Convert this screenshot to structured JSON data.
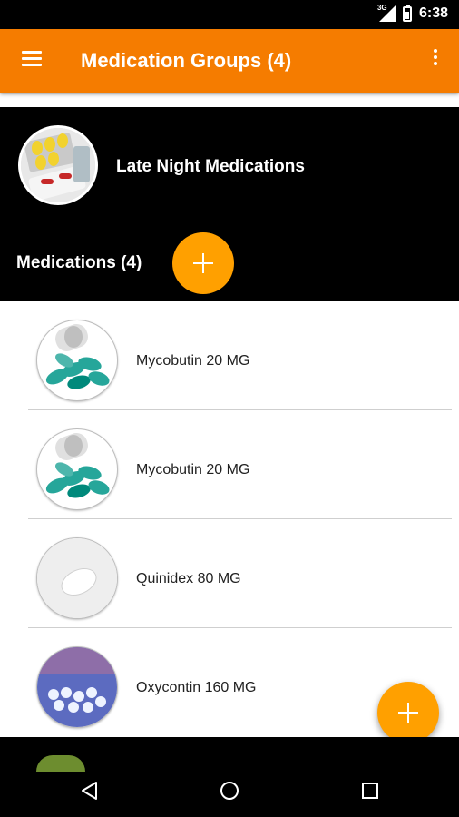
{
  "status_bar": {
    "network": "3G",
    "time": "6:38"
  },
  "app_bar": {
    "title": "Medication Groups (4)",
    "menu_icon": "hamburger-icon",
    "overflow_icon": "more-vert-icon",
    "color": "#f57c00"
  },
  "group": {
    "name": "Late Night Medications",
    "medications_label": "Medications (4)"
  },
  "medications": [
    {
      "name": "Mycobutin 20 MG",
      "image": "capsules-bottle"
    },
    {
      "name": "Mycobutin 20 MG",
      "image": "capsules-bottle"
    },
    {
      "name": "Quinidex 80 MG",
      "image": "white-tablet"
    },
    {
      "name": "Oxycontin 160 MG",
      "image": "pills-blue"
    }
  ],
  "fab": {
    "icon": "plus-icon",
    "color": "#ffa000"
  },
  "nav": {
    "back_icon": "back-triangle-icon",
    "home_icon": "home-circle-icon",
    "recents_icon": "recents-square-icon"
  }
}
